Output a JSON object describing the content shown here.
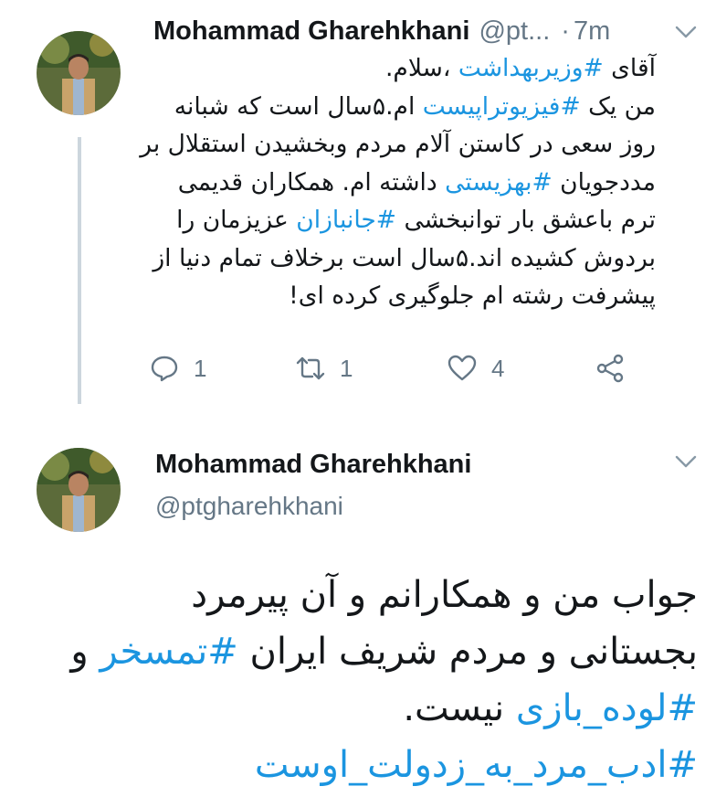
{
  "tweet1": {
    "author_name": "Mohammad Gharehkhani",
    "handle": "@pt...",
    "separator": "·",
    "time": "7m",
    "body_lines": [
      [
        {
          "t": "آقای "
        },
        {
          "t": "#وزیربهداشت",
          "tag": true
        },
        {
          "t": " ،سلام."
        }
      ],
      [
        {
          "t": "من یک "
        },
        {
          "t": "#فیزیوتراپیست",
          "tag": true
        },
        {
          "t": " ام.۵سال است که شبانه"
        }
      ],
      [
        {
          "t": "روز سعی در کاستن آلام مردم وبخشیدن استقلال بر"
        }
      ],
      [
        {
          "t": "مددجویان "
        },
        {
          "t": "#بهزیستی",
          "tag": true
        },
        {
          "t": " داشته ام. همکاران قدیمی"
        }
      ],
      [
        {
          "t": "ترم باعشق بار توانبخشی "
        },
        {
          "t": "#جانبازان",
          "tag": true
        },
        {
          "t": " عزیزمان را"
        }
      ],
      [
        {
          "t": "بردوش کشیده اند.۵سال است برخلاف تمام دنیا از"
        }
      ],
      [
        {
          "t": "پیشرفت رشته ام جلوگیری کرده ای!"
        }
      ]
    ],
    "actions": {
      "reply_icon": "reply-icon",
      "reply_count": "1",
      "retweet_icon": "retweet-icon",
      "retweet_count": "1",
      "like_icon": "heart-icon",
      "like_count": "4",
      "share_icon": "share-icon"
    }
  },
  "tweet2": {
    "author_name": "Mohammad Gharehkhani",
    "handle": "@ptgharehkhani",
    "body_lines": [
      [
        {
          "t": "جواب من و همکارانم و آن پیرمرد"
        }
      ],
      [
        {
          "t": "بجستانی و مردم شریف ایران "
        },
        {
          "t": "#تمسخر",
          "tag": true
        },
        {
          "t": " و"
        }
      ],
      [
        {
          "t": "#لوده_بازی",
          "tag": true
        },
        {
          "t": " نیست."
        }
      ],
      [
        {
          "t": "#ادب_مرد_به_زدولت_اوست",
          "tag": true
        }
      ]
    ]
  },
  "colors": {
    "link": "#1b95e0",
    "muted": "#657786",
    "text": "#14171a",
    "thread_line": "#ccd6dd"
  }
}
